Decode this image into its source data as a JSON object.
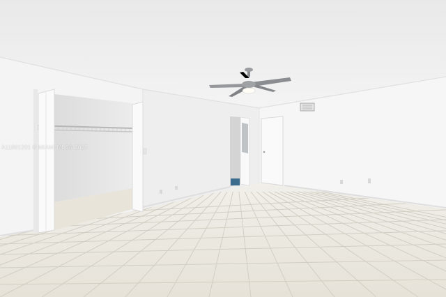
{
  "photo": {
    "watermark": "A11801201 © MIAMI MLS® 2025",
    "colors": {
      "ceiling": "#f0f0f0",
      "wall_left": "#f5f5f5",
      "wall_back": "#f3f3f3",
      "wall_right": "#f7f7f7",
      "floor": "#ebe8e0",
      "grout": "#c9c5bb",
      "closet_interior": "#e6e6e6",
      "door": "#f8f8f8",
      "fan_metal": "#8a8c90"
    }
  }
}
